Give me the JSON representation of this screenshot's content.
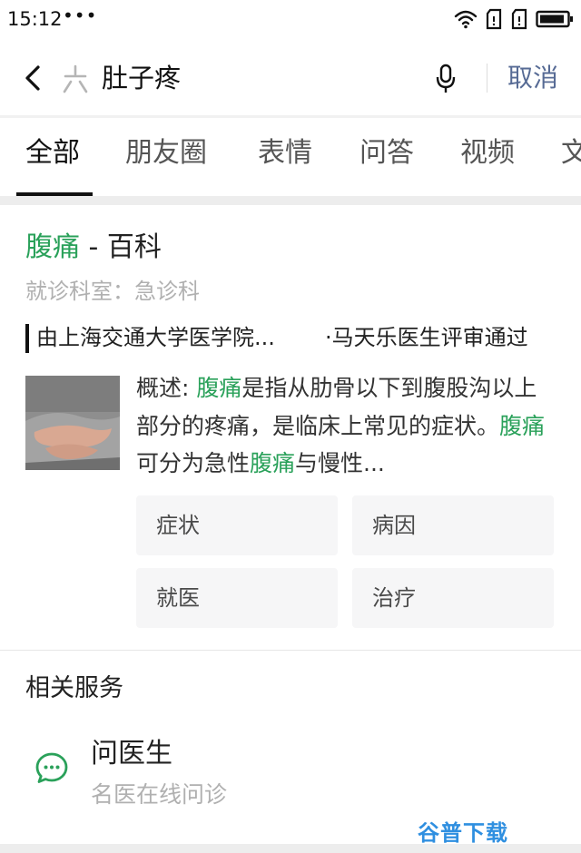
{
  "status_bar": {
    "time": "15:12",
    "dots": "•••"
  },
  "search": {
    "query": "肚子疼",
    "cancel_label": "取消"
  },
  "tabs": [
    {
      "label": "全部",
      "active": true
    },
    {
      "label": "朋友圈"
    },
    {
      "label": "表情"
    },
    {
      "label": "问答"
    },
    {
      "label": "视频"
    },
    {
      "label": "文"
    }
  ],
  "baike": {
    "title_term": "腹痛",
    "title_suffix": " - 百科",
    "department": "就诊科室：急诊科",
    "review_source": "由上海交通大学医学院...",
    "review_text": "·马天乐医生评审通过",
    "summary": {
      "label": "概述: ",
      "term": "腹痛",
      "text1": "是指从肋骨以下到腹股沟以上部分的疼痛，是临床上常见的症状。",
      "text2": "可分为急性",
      "text3": "与慢性..."
    },
    "buttons": {
      "symptoms": "症状",
      "causes": "病因",
      "seek_care": "就医",
      "treatment": "治疗"
    }
  },
  "related_services": {
    "title": "相关服务",
    "item": {
      "name": "问医生",
      "desc": "名医在线问诊"
    }
  },
  "watermark": "谷普下载",
  "colors": {
    "highlight": "#2aa15a",
    "link": "#576b95",
    "watermark": "#2f8fe0"
  },
  "icons": {
    "back": "chevron-left-icon",
    "logo": "search-logo-icon",
    "mic": "microphone-icon",
    "service": "chat-bubble-icon"
  }
}
